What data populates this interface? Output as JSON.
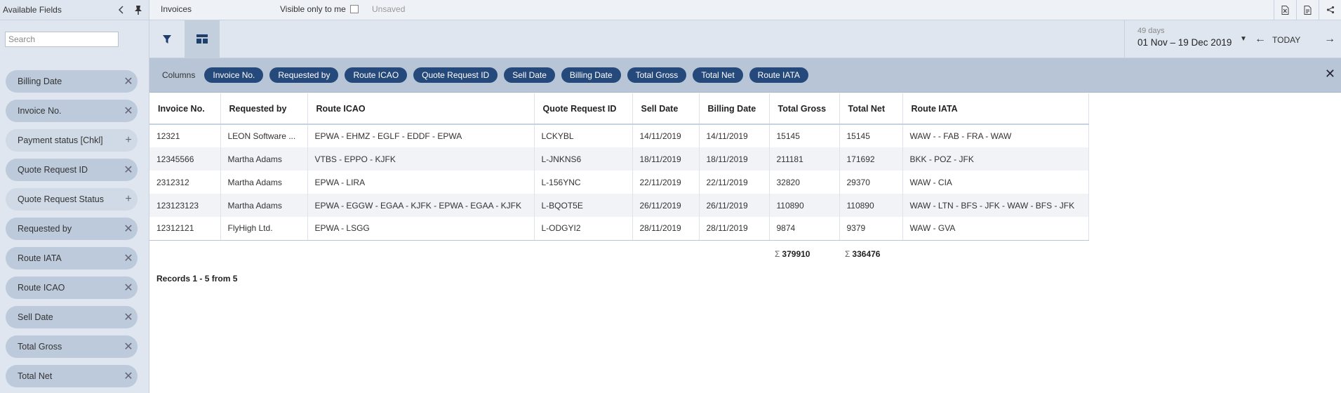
{
  "sidebar": {
    "title": "Available Fields",
    "search_placeholder": "Search",
    "fields": [
      {
        "label": "Billing Date",
        "action": "remove"
      },
      {
        "label": "Invoice No.",
        "action": "remove"
      },
      {
        "label": "Payment status [Chkl]",
        "action": "add"
      },
      {
        "label": "Quote Request ID",
        "action": "remove"
      },
      {
        "label": "Quote Request Status",
        "action": "add"
      },
      {
        "label": "Requested by",
        "action": "remove"
      },
      {
        "label": "Route IATA",
        "action": "remove"
      },
      {
        "label": "Route ICAO",
        "action": "remove"
      },
      {
        "label": "Sell Date",
        "action": "remove"
      },
      {
        "label": "Total Gross",
        "action": "remove"
      },
      {
        "label": "Total Net",
        "action": "remove"
      }
    ]
  },
  "topbar": {
    "title": "Invoices",
    "visible_only_label": "Visible only to me",
    "unsaved_label": "Unsaved"
  },
  "toolbar": {
    "days_label": "49 days",
    "date_range": "01 Nov – 19 Dec 2019",
    "today_label": "TODAY"
  },
  "columns_bar": {
    "label": "Columns",
    "chips": [
      "Invoice No.",
      "Requested by",
      "Route ICAO",
      "Quote Request ID",
      "Sell Date",
      "Billing Date",
      "Total Gross",
      "Total Net",
      "Route IATA"
    ]
  },
  "table": {
    "headers": [
      "Invoice No.",
      "Requested by",
      "Route ICAO",
      "Quote Request ID",
      "Sell Date",
      "Billing Date",
      "Total Gross",
      "Total Net",
      "Route IATA"
    ],
    "rows": [
      [
        "12321",
        "LEON Software ...",
        "EPWA - EHMZ - EGLF - EDDF - EPWA",
        "LCKYBL",
        "14/11/2019",
        "14/11/2019",
        "15145",
        "15145",
        "WAW - - FAB - FRA - WAW"
      ],
      [
        "12345566",
        "Martha Adams",
        "VTBS - EPPO - KJFK",
        "L-JNKNS6",
        "18/11/2019",
        "18/11/2019",
        "211181",
        "171692",
        "BKK - POZ - JFK"
      ],
      [
        "2312312",
        "Martha Adams",
        "EPWA - LIRA",
        "L-156YNC",
        "22/11/2019",
        "22/11/2019",
        "32820",
        "29370",
        "WAW - CIA"
      ],
      [
        "123123123",
        "Martha Adams",
        "EPWA - EGGW - EGAA - KJFK - EPWA - EGAA - KJFK",
        "L-BQOT5E",
        "26/11/2019",
        "26/11/2019",
        "110890",
        "110890",
        "WAW - LTN - BFS - JFK - WAW - BFS - JFK"
      ],
      [
        "12312121",
        "FlyHigh Ltd.",
        "EPWA - LSGG",
        "L-ODGYI2",
        "28/11/2019",
        "28/11/2019",
        "9874",
        "9379",
        "WAW - GVA"
      ]
    ],
    "sum_symbol": "Σ",
    "total_gross_sum": "379910",
    "total_net_sum": "336476"
  },
  "footer": {
    "records": "Records 1 - 5 from 5"
  }
}
